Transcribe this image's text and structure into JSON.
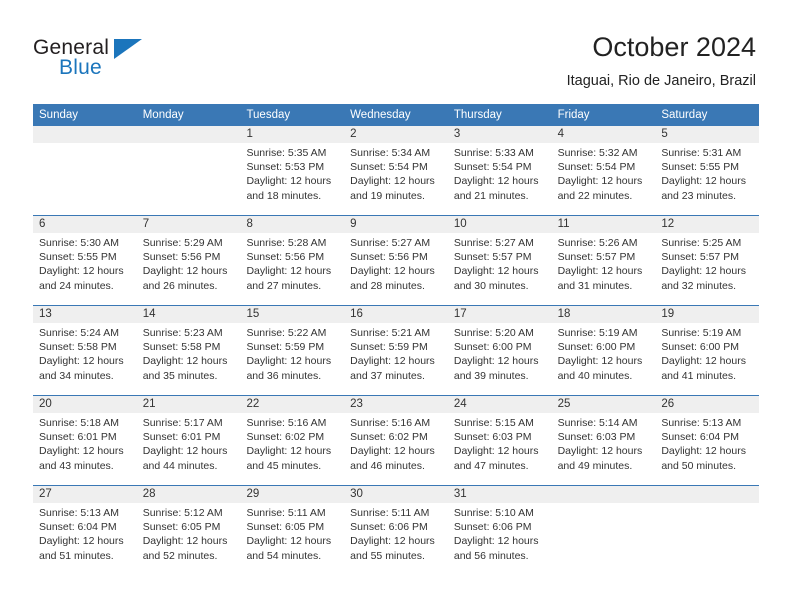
{
  "brand": {
    "name_part1": "General",
    "name_part2": "Blue",
    "accent_color": "#1b75bc"
  },
  "header": {
    "title": "October 2024",
    "subtitle": "Itaguai, Rio de Janeiro, Brazil"
  },
  "theme": {
    "header_blue": "#3a78b5",
    "daynum_band": "#efefef",
    "text": "#333333"
  },
  "weekdays": [
    "Sunday",
    "Monday",
    "Tuesday",
    "Wednesday",
    "Thursday",
    "Friday",
    "Saturday"
  ],
  "weeks": [
    {
      "days": [
        {
          "num": "",
          "sunrise": "",
          "sunset": "",
          "daylight_1": "",
          "daylight_2": ""
        },
        {
          "num": "",
          "sunrise": "",
          "sunset": "",
          "daylight_1": "",
          "daylight_2": ""
        },
        {
          "num": "1",
          "sunrise": "Sunrise: 5:35 AM",
          "sunset": "Sunset: 5:53 PM",
          "daylight_1": "Daylight: 12 hours",
          "daylight_2": "and 18 minutes."
        },
        {
          "num": "2",
          "sunrise": "Sunrise: 5:34 AM",
          "sunset": "Sunset: 5:54 PM",
          "daylight_1": "Daylight: 12 hours",
          "daylight_2": "and 19 minutes."
        },
        {
          "num": "3",
          "sunrise": "Sunrise: 5:33 AM",
          "sunset": "Sunset: 5:54 PM",
          "daylight_1": "Daylight: 12 hours",
          "daylight_2": "and 21 minutes."
        },
        {
          "num": "4",
          "sunrise": "Sunrise: 5:32 AM",
          "sunset": "Sunset: 5:54 PM",
          "daylight_1": "Daylight: 12 hours",
          "daylight_2": "and 22 minutes."
        },
        {
          "num": "5",
          "sunrise": "Sunrise: 5:31 AM",
          "sunset": "Sunset: 5:55 PM",
          "daylight_1": "Daylight: 12 hours",
          "daylight_2": "and 23 minutes."
        }
      ]
    },
    {
      "days": [
        {
          "num": "6",
          "sunrise": "Sunrise: 5:30 AM",
          "sunset": "Sunset: 5:55 PM",
          "daylight_1": "Daylight: 12 hours",
          "daylight_2": "and 24 minutes."
        },
        {
          "num": "7",
          "sunrise": "Sunrise: 5:29 AM",
          "sunset": "Sunset: 5:56 PM",
          "daylight_1": "Daylight: 12 hours",
          "daylight_2": "and 26 minutes."
        },
        {
          "num": "8",
          "sunrise": "Sunrise: 5:28 AM",
          "sunset": "Sunset: 5:56 PM",
          "daylight_1": "Daylight: 12 hours",
          "daylight_2": "and 27 minutes."
        },
        {
          "num": "9",
          "sunrise": "Sunrise: 5:27 AM",
          "sunset": "Sunset: 5:56 PM",
          "daylight_1": "Daylight: 12 hours",
          "daylight_2": "and 28 minutes."
        },
        {
          "num": "10",
          "sunrise": "Sunrise: 5:27 AM",
          "sunset": "Sunset: 5:57 PM",
          "daylight_1": "Daylight: 12 hours",
          "daylight_2": "and 30 minutes."
        },
        {
          "num": "11",
          "sunrise": "Sunrise: 5:26 AM",
          "sunset": "Sunset: 5:57 PM",
          "daylight_1": "Daylight: 12 hours",
          "daylight_2": "and 31 minutes."
        },
        {
          "num": "12",
          "sunrise": "Sunrise: 5:25 AM",
          "sunset": "Sunset: 5:57 PM",
          "daylight_1": "Daylight: 12 hours",
          "daylight_2": "and 32 minutes."
        }
      ]
    },
    {
      "days": [
        {
          "num": "13",
          "sunrise": "Sunrise: 5:24 AM",
          "sunset": "Sunset: 5:58 PM",
          "daylight_1": "Daylight: 12 hours",
          "daylight_2": "and 34 minutes."
        },
        {
          "num": "14",
          "sunrise": "Sunrise: 5:23 AM",
          "sunset": "Sunset: 5:58 PM",
          "daylight_1": "Daylight: 12 hours",
          "daylight_2": "and 35 minutes."
        },
        {
          "num": "15",
          "sunrise": "Sunrise: 5:22 AM",
          "sunset": "Sunset: 5:59 PM",
          "daylight_1": "Daylight: 12 hours",
          "daylight_2": "and 36 minutes."
        },
        {
          "num": "16",
          "sunrise": "Sunrise: 5:21 AM",
          "sunset": "Sunset: 5:59 PM",
          "daylight_1": "Daylight: 12 hours",
          "daylight_2": "and 37 minutes."
        },
        {
          "num": "17",
          "sunrise": "Sunrise: 5:20 AM",
          "sunset": "Sunset: 6:00 PM",
          "daylight_1": "Daylight: 12 hours",
          "daylight_2": "and 39 minutes."
        },
        {
          "num": "18",
          "sunrise": "Sunrise: 5:19 AM",
          "sunset": "Sunset: 6:00 PM",
          "daylight_1": "Daylight: 12 hours",
          "daylight_2": "and 40 minutes."
        },
        {
          "num": "19",
          "sunrise": "Sunrise: 5:19 AM",
          "sunset": "Sunset: 6:00 PM",
          "daylight_1": "Daylight: 12 hours",
          "daylight_2": "and 41 minutes."
        }
      ]
    },
    {
      "days": [
        {
          "num": "20",
          "sunrise": "Sunrise: 5:18 AM",
          "sunset": "Sunset: 6:01 PM",
          "daylight_1": "Daylight: 12 hours",
          "daylight_2": "and 43 minutes."
        },
        {
          "num": "21",
          "sunrise": "Sunrise: 5:17 AM",
          "sunset": "Sunset: 6:01 PM",
          "daylight_1": "Daylight: 12 hours",
          "daylight_2": "and 44 minutes."
        },
        {
          "num": "22",
          "sunrise": "Sunrise: 5:16 AM",
          "sunset": "Sunset: 6:02 PM",
          "daylight_1": "Daylight: 12 hours",
          "daylight_2": "and 45 minutes."
        },
        {
          "num": "23",
          "sunrise": "Sunrise: 5:16 AM",
          "sunset": "Sunset: 6:02 PM",
          "daylight_1": "Daylight: 12 hours",
          "daylight_2": "and 46 minutes."
        },
        {
          "num": "24",
          "sunrise": "Sunrise: 5:15 AM",
          "sunset": "Sunset: 6:03 PM",
          "daylight_1": "Daylight: 12 hours",
          "daylight_2": "and 47 minutes."
        },
        {
          "num": "25",
          "sunrise": "Sunrise: 5:14 AM",
          "sunset": "Sunset: 6:03 PM",
          "daylight_1": "Daylight: 12 hours",
          "daylight_2": "and 49 minutes."
        },
        {
          "num": "26",
          "sunrise": "Sunrise: 5:13 AM",
          "sunset": "Sunset: 6:04 PM",
          "daylight_1": "Daylight: 12 hours",
          "daylight_2": "and 50 minutes."
        }
      ]
    },
    {
      "days": [
        {
          "num": "27",
          "sunrise": "Sunrise: 5:13 AM",
          "sunset": "Sunset: 6:04 PM",
          "daylight_1": "Daylight: 12 hours",
          "daylight_2": "and 51 minutes."
        },
        {
          "num": "28",
          "sunrise": "Sunrise: 5:12 AM",
          "sunset": "Sunset: 6:05 PM",
          "daylight_1": "Daylight: 12 hours",
          "daylight_2": "and 52 minutes."
        },
        {
          "num": "29",
          "sunrise": "Sunrise: 5:11 AM",
          "sunset": "Sunset: 6:05 PM",
          "daylight_1": "Daylight: 12 hours",
          "daylight_2": "and 54 minutes."
        },
        {
          "num": "30",
          "sunrise": "Sunrise: 5:11 AM",
          "sunset": "Sunset: 6:06 PM",
          "daylight_1": "Daylight: 12 hours",
          "daylight_2": "and 55 minutes."
        },
        {
          "num": "31",
          "sunrise": "Sunrise: 5:10 AM",
          "sunset": "Sunset: 6:06 PM",
          "daylight_1": "Daylight: 12 hours",
          "daylight_2": "and 56 minutes."
        },
        {
          "num": "",
          "sunrise": "",
          "sunset": "",
          "daylight_1": "",
          "daylight_2": ""
        },
        {
          "num": "",
          "sunrise": "",
          "sunset": "",
          "daylight_1": "",
          "daylight_2": ""
        }
      ]
    }
  ]
}
